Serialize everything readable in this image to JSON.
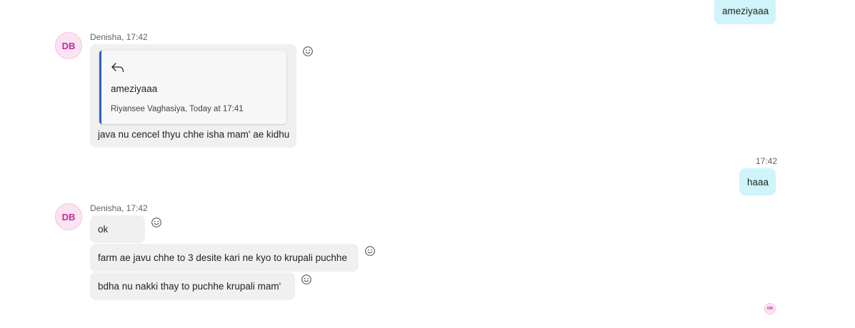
{
  "messages": {
    "m1": {
      "text": "ameziyaaa"
    },
    "m2": {
      "sender": "Denisha, 17:42",
      "avatar": "DB",
      "quote": {
        "icon": "reply-icon",
        "text": "ameziyaaa",
        "meta": "Riyansee Vaghasiya, Today at 17:41"
      },
      "text": "java nu cencel thyu chhe isha mam' ae kidhu"
    },
    "m3": {
      "time": "17:42",
      "text": "haaa"
    },
    "m4": {
      "sender": "Denisha, 17:42",
      "avatar": "DB",
      "lines": [
        "ok",
        "farm ae javu chhe to 3 desite kari ne kyo  to krupali puchhe",
        "bdha nu nakki  thay to puchhe krupali mam'"
      ]
    }
  },
  "read_receipt": {
    "avatar": "DB"
  },
  "icons": {
    "react": "smiley-icon",
    "reply": "reply-icon"
  },
  "colors": {
    "incoming_bubble": "#f0f0f0",
    "outgoing_bubble": "#cff4fa",
    "avatar_bg": "#fbe3f1",
    "avatar_text": "#c02c9c",
    "quote_accent": "#2b65c0"
  }
}
